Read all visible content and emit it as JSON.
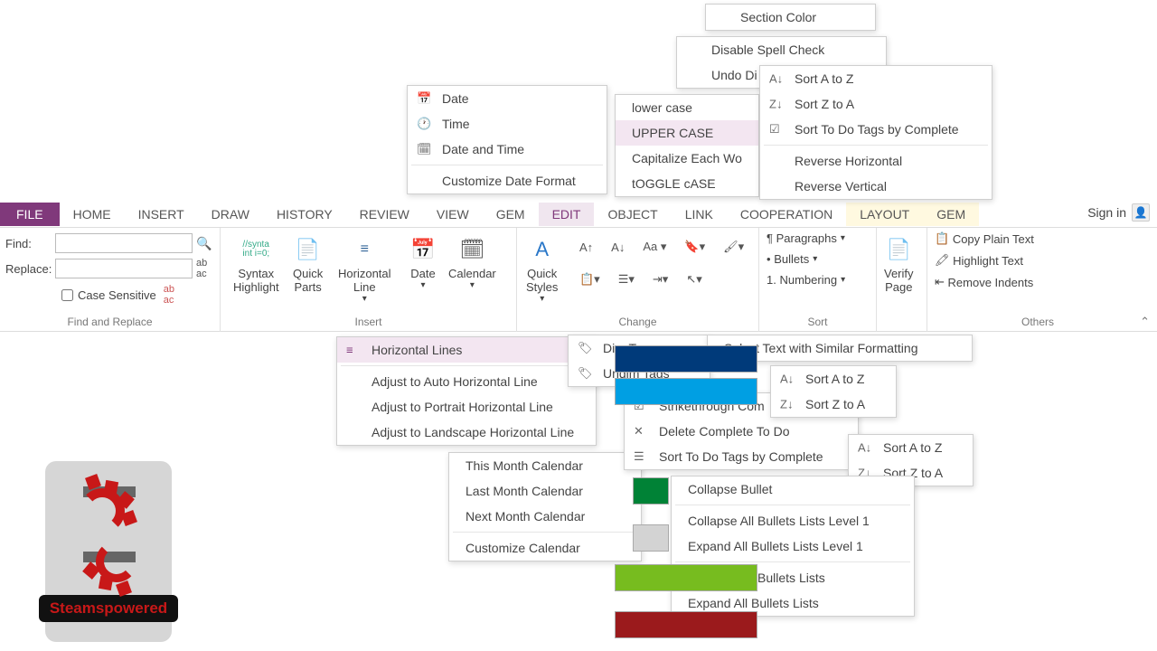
{
  "tabs": {
    "file": "FILE",
    "list": [
      "HOME",
      "INSERT",
      "DRAW",
      "HISTORY",
      "REVIEW",
      "VIEW",
      "GEM",
      "EDIT",
      "OBJECT",
      "LINK",
      "COOPERATION",
      "LAYOUT",
      "GEM"
    ],
    "active": "EDIT",
    "signin": "Sign in"
  },
  "find_replace": {
    "find_label": "Find:",
    "replace_label": "Replace:",
    "case_label": "Case Sensitive",
    "group": "Find and Replace"
  },
  "insert": {
    "syntax": "Syntax\nHighlight",
    "quickparts": "Quick\nParts",
    "hline": "Horizontal\nLine",
    "date": "Date",
    "calendar": "Calendar",
    "group": "Insert"
  },
  "change": {
    "quickstyles": "Quick\nStyles",
    "group": "Change"
  },
  "sort": {
    "paragraphs": "Paragraphs",
    "bullets": "Bullets",
    "numbering": "Numbering",
    "group": "Sort"
  },
  "verify": "Verify\nPage",
  "others": {
    "copy": "Copy Plain Text",
    "highlight": "Highlight Text",
    "remove": "Remove Indents",
    "group": "Others"
  },
  "menus": {
    "section_color": "Section Color",
    "disable_spell": "Disable Spell Check",
    "undo_di": "Undo Di",
    "date_items": [
      "Date",
      "Time",
      "Date and Time",
      "Customize Date Format"
    ],
    "case_items": [
      "lower case",
      "UPPER CASE",
      "Capitalize Each Wo",
      "tOGGLE cASE"
    ],
    "sort1": [
      "Sort A to Z",
      "Sort Z to A",
      "Sort To Do Tags by Complete",
      "Reverse Horizontal",
      "Reverse Vertical"
    ],
    "hline_items": [
      "Horizontal Lines",
      "Adjust to Auto Horizontal Line",
      "Adjust to Portrait Horizontal Line",
      "Adjust to Landscape Horizontal Line"
    ],
    "tag_items": [
      "Dim Tags",
      "Undim Tags"
    ],
    "calendar_items": [
      "This Month Calendar",
      "Last Month Calendar",
      "Next Month Calendar",
      "Customize Calendar"
    ],
    "select_similar": "Select Text with Similar Formatting",
    "todo_items": [
      "Strikethrough Com",
      "Delete Complete To Do",
      "Sort To Do Tags by Complete"
    ],
    "sort2": [
      "Sort A to Z",
      "Sort Z to A"
    ],
    "sort3": [
      "Sort A to Z",
      "Sort Z to A"
    ],
    "bullet_items": [
      "Collapse Bullet",
      "Collapse All Bullets Lists Level 1",
      "Expand All Bullets Lists Level 1",
      "Collapse All Bullets Lists",
      "Expand All Bullets Lists"
    ]
  },
  "logo_text": "Steamspowered",
  "colors": {
    "accent": "#80397b",
    "swatches": [
      "#003a7a",
      "#009fe3",
      "#008236",
      "#ffffff",
      "#77bc1f",
      "#9b1a1c"
    ]
  }
}
